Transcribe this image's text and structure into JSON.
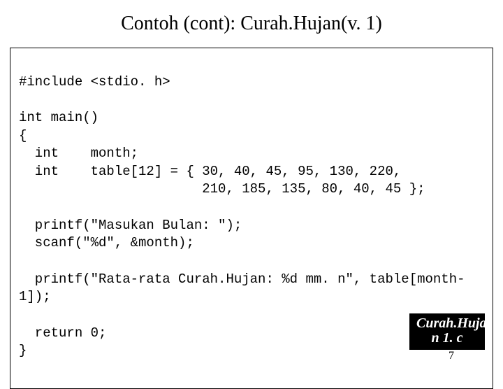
{
  "title": "Contoh (cont): Curah.Hujan(v. 1)",
  "code": {
    "l1": "#include <stdio. h>",
    "l2": "",
    "l3": "int main()",
    "l4": "{",
    "l5": "  int    month;",
    "l6": "  int    table[12] = { 30, 40, 45, 95, 130, 220,",
    "l7": "                       210, 185, 135, 80, 40, 45 };",
    "l8": "",
    "l9": "  printf(\"Masukan Bulan: \");",
    "l10": "  scanf(\"%d\", &month);",
    "l11": "",
    "l12": "  printf(\"Rata-rata Curah.Hujan: %d mm. n\", table[month-",
    "l13": "1]);",
    "l14": "",
    "l15": "  return 0;",
    "l16": "}"
  },
  "label": {
    "line1": "Curah.Huja",
    "line2": "n 1. c"
  },
  "page_number": "7"
}
